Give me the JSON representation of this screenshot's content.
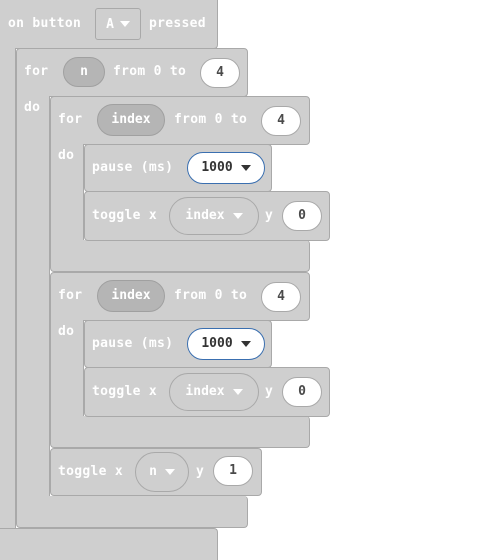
{
  "event": {
    "prefix": "on button",
    "button_value": "A",
    "suffix": "pressed"
  },
  "loop_outer": {
    "for_label": "for",
    "var": "n",
    "range_label": "from 0 to",
    "end": "4",
    "do_label": "do"
  },
  "loop1": {
    "for_label": "for",
    "var": "index",
    "range_label": "from 0 to",
    "end": "4",
    "do_label": "do",
    "pause_label": "pause (ms)",
    "pause_value": "1000",
    "toggle_label": "toggle x",
    "toggle_x": "index",
    "y_label": "y",
    "toggle_y": "0"
  },
  "loop2": {
    "for_label": "for",
    "var": "index",
    "range_label": "from 0 to",
    "end": "4",
    "do_label": "do",
    "pause_label": "pause (ms)",
    "pause_value": "1000",
    "toggle_label": "toggle x",
    "toggle_x": "index",
    "y_label": "y",
    "toggle_y": "0"
  },
  "final_toggle": {
    "toggle_label": "toggle x",
    "x": "n",
    "y_label": "y",
    "y": "1"
  }
}
